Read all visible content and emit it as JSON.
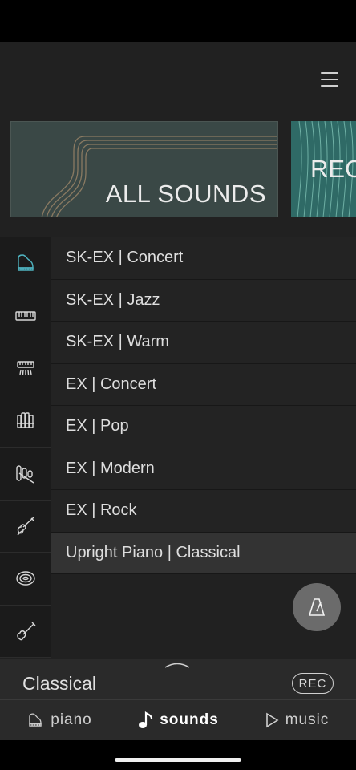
{
  "banners": [
    {
      "title": "ALL SOUNDS"
    },
    {
      "title": "REC"
    }
  ],
  "categories": [
    {
      "icon": "grand-piano-icon",
      "active": true
    },
    {
      "icon": "keyboard-icon",
      "active": false
    },
    {
      "icon": "electric-piano-icon",
      "active": false
    },
    {
      "icon": "organ-icon",
      "active": false
    },
    {
      "icon": "mallet-percussion-icon",
      "active": false
    },
    {
      "icon": "violin-icon",
      "active": false
    },
    {
      "icon": "pad-icon",
      "active": false
    },
    {
      "icon": "guitar-icon",
      "active": false
    }
  ],
  "sounds": [
    {
      "label": "SK-EX | Concert"
    },
    {
      "label": "SK-EX | Jazz"
    },
    {
      "label": "SK-EX | Warm"
    },
    {
      "label": "EX | Concert"
    },
    {
      "label": "EX | Pop"
    },
    {
      "label": "EX | Modern"
    },
    {
      "label": "EX | Rock"
    },
    {
      "label": "Upright Piano | Classical",
      "selected": true
    }
  ],
  "current": {
    "sound": "Classical",
    "rec_label": "REC"
  },
  "tabs": [
    {
      "label": "piano",
      "icon": "grand-piano-icon"
    },
    {
      "label": "sounds",
      "icon": "music-note-icon",
      "active": true
    },
    {
      "label": "music",
      "icon": "play-icon"
    }
  ],
  "colors": {
    "accent": "#4fb3c0",
    "background": "#212121",
    "selected_row": "#333333"
  }
}
